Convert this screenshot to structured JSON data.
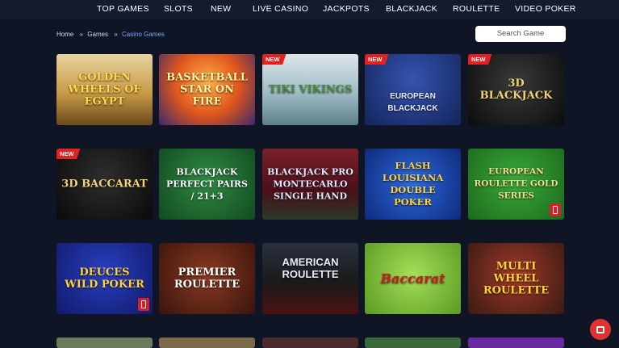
{
  "nav": {
    "items": [
      {
        "label": "TOP GAMES"
      },
      {
        "label": "SLOTS"
      },
      {
        "label": "NEW"
      },
      {
        "label": "LIVE CASINO"
      },
      {
        "label": "JACKPOTS"
      },
      {
        "label": "BLACKJACK"
      },
      {
        "label": "ROULETTE"
      },
      {
        "label": "VIDEO POKER"
      }
    ]
  },
  "breadcrumb": {
    "home": "Home",
    "games": "Games",
    "current": "Casino Games",
    "separator": "»"
  },
  "search": {
    "placeholder": "Search Game"
  },
  "badges": {
    "new": "NEW"
  },
  "games": [
    {
      "title": "GOLDEN WHEELS OF EGYPT",
      "accent": "#c9a44a"
    },
    {
      "title": "BASKETBALL STAR ON FIRE",
      "accent": "#f28a1c"
    },
    {
      "title": "TIKI VIKINGS",
      "accent": "#9ac0c8"
    },
    {
      "title": "EUROPEAN BLACKJACK",
      "accent": "#1f3a8a"
    },
    {
      "title": "3D BLACKJACK",
      "accent": "#1a1a1a"
    },
    {
      "title": "3D BACCARAT",
      "accent": "#1c1c1c"
    },
    {
      "title": "BLACKJACK PERFECT PAIRS / 21+3",
      "accent": "#1f6b2f"
    },
    {
      "title": "BLACKJACK PRO MONTECARLO SINGLE HAND",
      "accent": "#7a1f2a"
    },
    {
      "title": "FLASH LOUISIANA DOUBLE POKER",
      "accent": "#1a4fb8"
    },
    {
      "title": "EUROPEAN ROULETTE GOLD SERIES",
      "accent": "#2f8a2f"
    },
    {
      "title": "DEUCES WILD POKER",
      "accent": "#1a2e9a"
    },
    {
      "title": "PREMIER ROULETTE",
      "accent": "#6e2a1e"
    },
    {
      "title": "AMERICAN ROULETTE",
      "accent": "#1e2430"
    },
    {
      "title": "Baccarat",
      "accent": "#7cc242"
    },
    {
      "title": "MULTI WHEEL ROULETTE",
      "accent": "#8a1f1f"
    }
  ]
}
